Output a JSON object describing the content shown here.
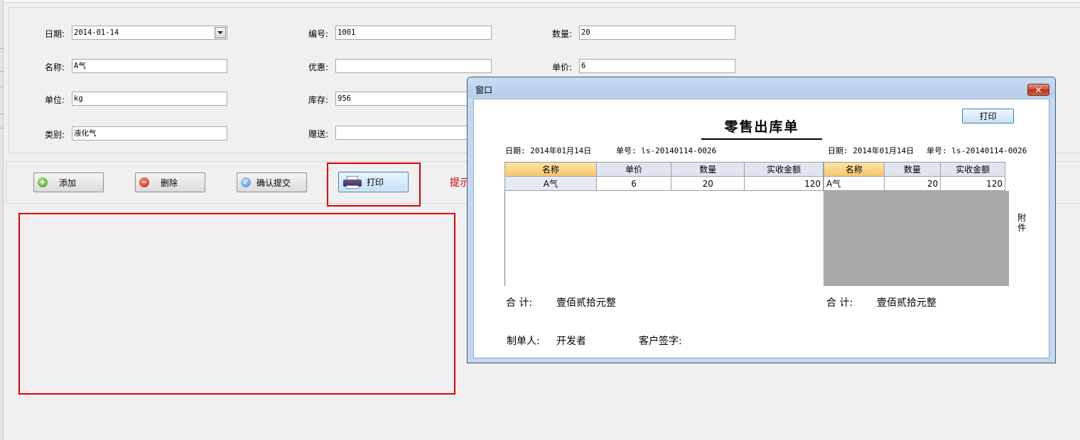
{
  "form": {
    "date": {
      "label": "日期:",
      "value": "2014-01-14"
    },
    "code": {
      "label": "编号:",
      "value": "1001"
    },
    "quantity": {
      "label": "数量:",
      "value": "20"
    },
    "name": {
      "label": "名称:",
      "value": "A气"
    },
    "discount": {
      "label": "优惠:",
      "value": ""
    },
    "unit_price": {
      "label": "单价:",
      "value": "6"
    },
    "unit": {
      "label": "单位:",
      "value": "kg"
    },
    "stock": {
      "label": "库存:",
      "value": "956"
    },
    "category": {
      "label": "类别:",
      "value": "液化气"
    },
    "gift": {
      "label": "赠送:",
      "value": ""
    }
  },
  "toolbar": {
    "add_label": "添加",
    "delete_label": "删除",
    "confirm_label": "确认提交",
    "print_label": "打印",
    "hint": "提示"
  },
  "dialog": {
    "title": "窗口",
    "close_glyph": "✕",
    "print_label": "打印",
    "receipt_title": "零售出库单",
    "left": {
      "date_text": "日期: 2014年01月14日",
      "order_text": "单号: ls-20140114-0026",
      "columns": [
        "名称",
        "单价",
        "数量",
        "实收金额"
      ],
      "rows": [
        [
          "A气",
          "6",
          "20",
          "120"
        ]
      ],
      "total_label": "合  计:",
      "total_value": "壹佰贰拾元整"
    },
    "right": {
      "date_text": "日期: 2014年01月14日",
      "order_text": "单号: ls-20140114-0026",
      "columns": [
        "名称",
        "数量",
        "实收金额"
      ],
      "rows": [
        [
          "A气",
          "20",
          "120"
        ]
      ],
      "total_label": "合  计:",
      "total_value": "壹佰贰拾元整"
    },
    "attachment_label": "附件",
    "maker_label": "制单人:",
    "maker_value": "开发者",
    "customer_sign_label": "客户签字:"
  },
  "colors": {
    "highlight": "#e00000",
    "hint": "#d40000",
    "grid_gray": "#a9a9a9"
  }
}
